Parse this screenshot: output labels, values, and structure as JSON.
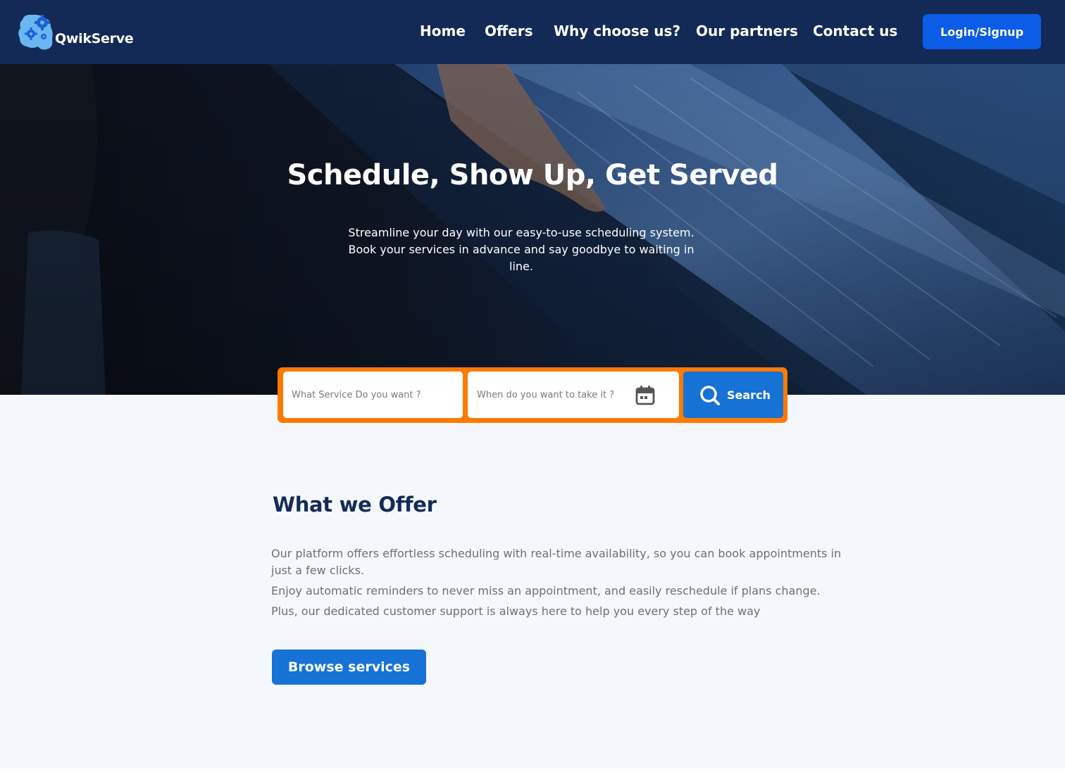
{
  "colors": {
    "navbar": "#132a56",
    "primary_button": "#0b5ce6",
    "accent_orange": "#ff7a00",
    "search_button": "#1672d4",
    "heading_navy": "#142b55",
    "body_gray": "#707070",
    "page_background": "#f4f8fc"
  },
  "header": {
    "logo_icon": "gears-cloud-icon",
    "brand": "QwikServe",
    "nav": {
      "home": "Home",
      "offers": "Offers",
      "why": "Why choose us?",
      "partners": "Our partners",
      "contact": "Contact us"
    },
    "login_label": "Login/Signup"
  },
  "hero": {
    "background": "dark blue photo of a hand touching an illuminated touchscreen control panel",
    "title": "Schedule, Show Up, Get Served",
    "subtitle": "Streamline your day with our easy-to-use scheduling system. Book your services in advance and say goodbye to waiting in line."
  },
  "search": {
    "service_placeholder": "What Service Do you want ?",
    "date_placeholder": "When do you want to take it ?",
    "date_icon": "calendar-icon",
    "button_icon": "search-icon",
    "button_label": "Search"
  },
  "offer": {
    "title": "What we Offer",
    "paragraphs": [
      "Our platform offers effortless scheduling with real-time availability, so you can book appointments in just a few clicks.",
      "Enjoy automatic reminders to never miss an appointment, and easily reschedule if plans change.",
      "Plus, our dedicated customer support is always here to help you every step of the way"
    ],
    "button_label": "Browse services"
  }
}
